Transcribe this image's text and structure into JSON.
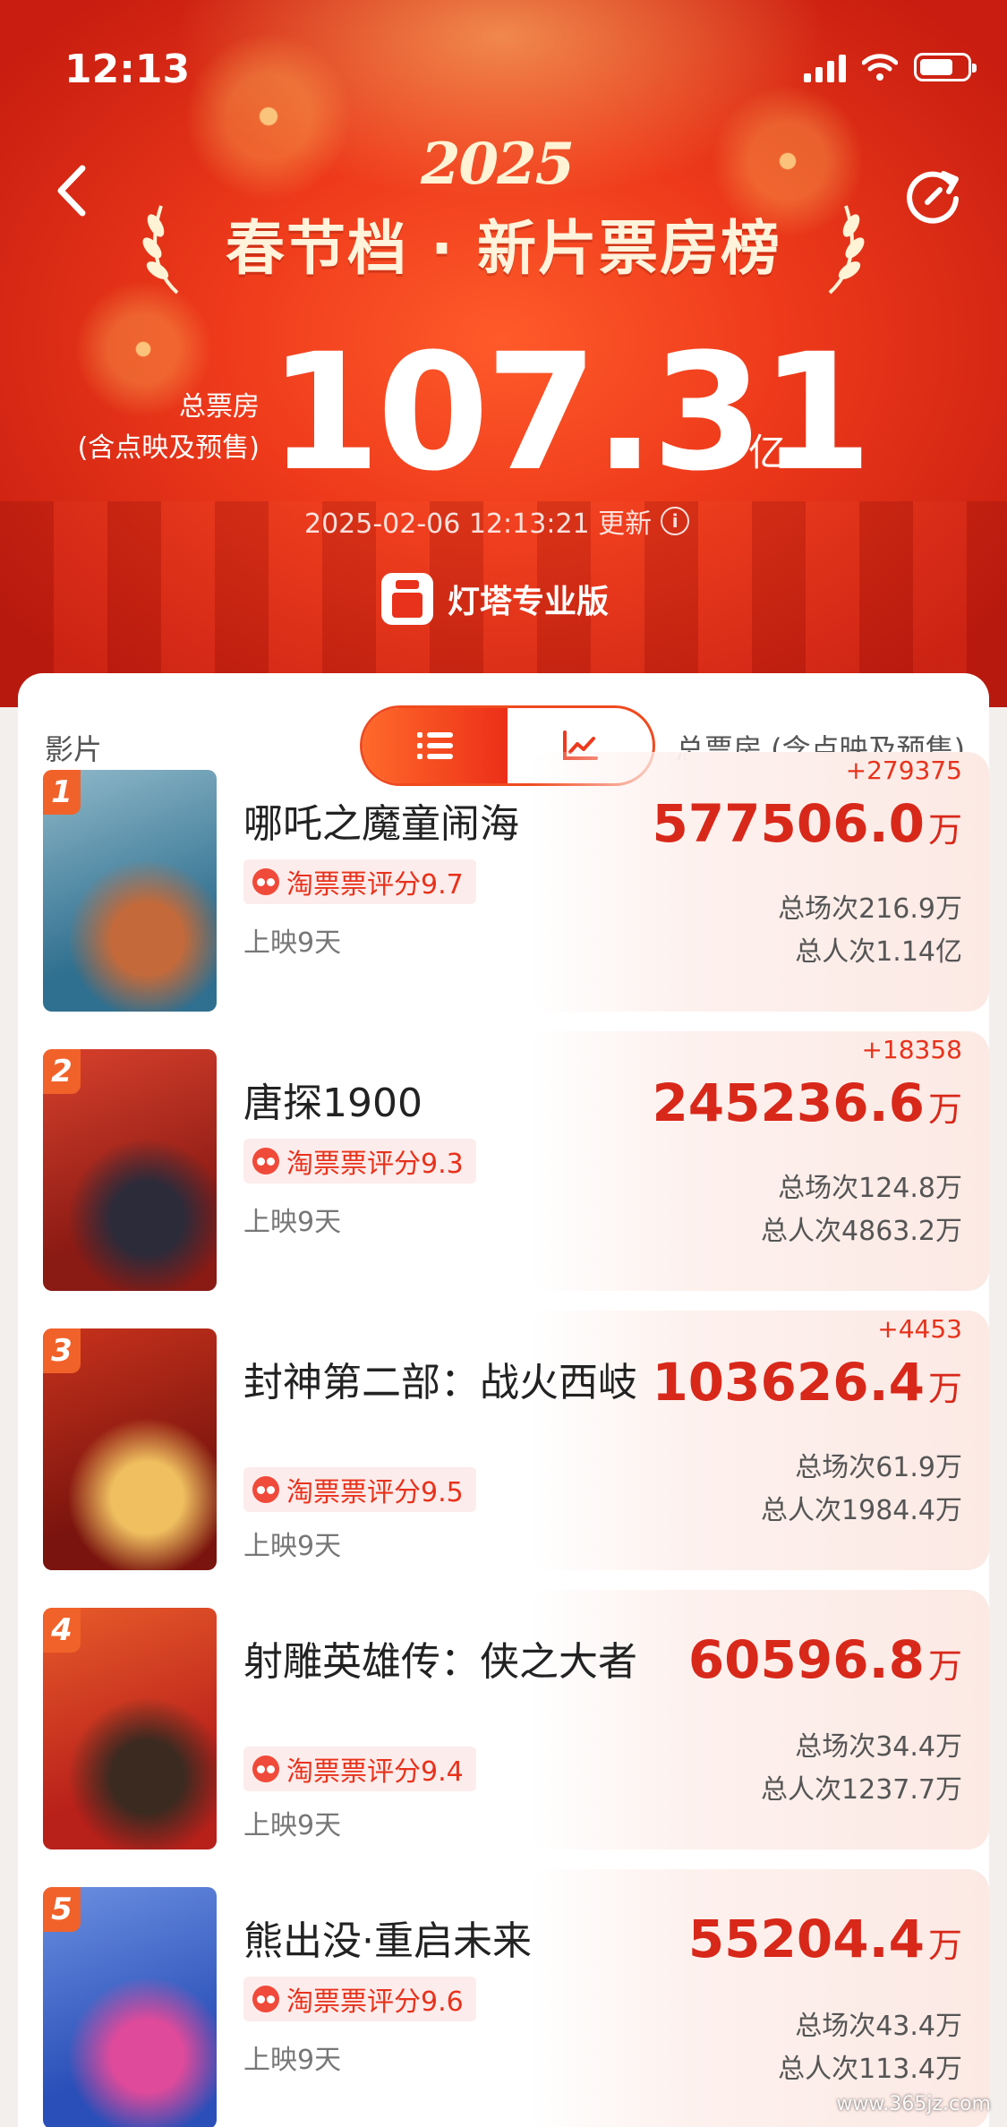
{
  "status_bar": {
    "time": "12:13"
  },
  "header": {
    "year": "2025",
    "title": "春节档 · 新片票房榜",
    "total_label_line1": "总票房",
    "total_label_line2": "(含点映及预售)",
    "total_value": "107.31",
    "total_unit": "亿",
    "update_time": "2025-02-06 12:13:21 更新",
    "brand": "灯塔专业版"
  },
  "table": {
    "col_film": "影片",
    "col_total": "总票房 (含点映及预售)",
    "view_modes": [
      "list-icon",
      "chart-icon"
    ]
  },
  "movies": [
    {
      "rank": "1",
      "title": "哪吒之魔童闹海",
      "rating": "淘票票评分9.7",
      "days": "上映9天",
      "delta": "+279375",
      "gross": "577506.0",
      "unit": "万",
      "shows": "总场次216.9万",
      "viewers": "总人次1.14亿",
      "poster_colors": [
        "#2f6f8f",
        "#8fb8c9",
        "#c46a3a"
      ]
    },
    {
      "rank": "2",
      "title": "唐探1900",
      "rating": "淘票票评分9.3",
      "days": "上映9天",
      "delta": "+18358",
      "gross": "245236.6",
      "unit": "万",
      "shows": "总场次124.8万",
      "viewers": "总人次4863.2万",
      "poster_colors": [
        "#8a1a14",
        "#d8402c",
        "#2b2b3a"
      ]
    },
    {
      "rank": "3",
      "title": "封神第二部：战火西岐",
      "rating": "淘票票评分9.5",
      "days": "上映9天",
      "delta": "+4453",
      "gross": "103626.4",
      "unit": "万",
      "shows": "总场次61.9万",
      "viewers": "总人次1984.4万",
      "poster_colors": [
        "#7a140e",
        "#c8321c",
        "#f0c060"
      ]
    },
    {
      "rank": "4",
      "title": "射雕英雄传：侠之大者",
      "rating": "淘票票评分9.4",
      "days": "上映9天",
      "delta": "",
      "gross": "60596.8",
      "unit": "万",
      "shows": "总场次34.4万",
      "viewers": "总人次1237.7万",
      "poster_colors": [
        "#b8201a",
        "#e85a2a",
        "#3a2a20"
      ]
    },
    {
      "rank": "5",
      "title": "熊出没·重启未来",
      "rating": "淘票票评分9.6",
      "days": "上映9天",
      "delta": "",
      "gross": "55204.4",
      "unit": "万",
      "shows": "总场次43.4万",
      "viewers": "总人次113.4万",
      "poster_colors": [
        "#2a4fb8",
        "#6a8fe0",
        "#e04a9a"
      ]
    }
  ],
  "watermark": "www.365jz.com",
  "colors": {
    "accent": "#e8321b",
    "hero": "#ee3a1b",
    "rating_bg": "#fdecec"
  }
}
